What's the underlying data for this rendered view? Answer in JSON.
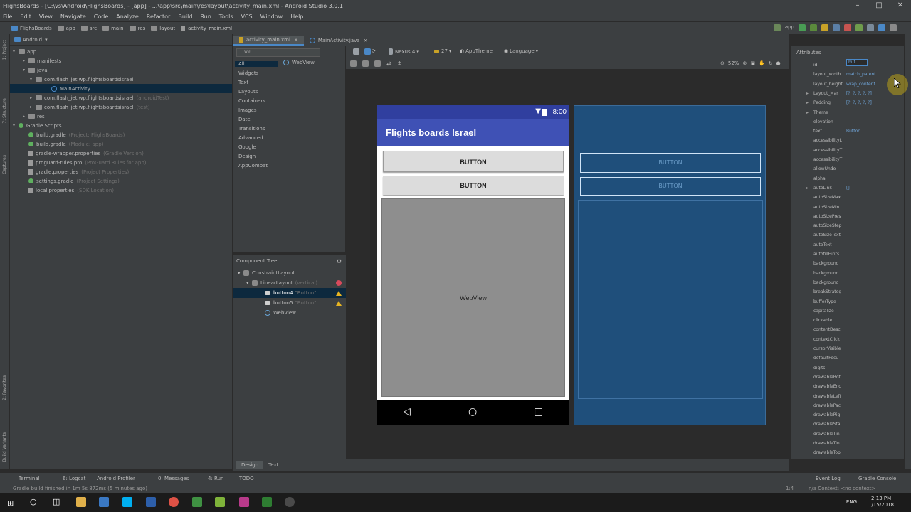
{
  "window": {
    "title": "FlighsBoards - [C:\\vs\\Android\\FlighsBoards] - [app] - ...\\app\\src\\main\\res\\layout\\activity_main.xml - Android Studio 3.0.1"
  },
  "menu": [
    "File",
    "Edit",
    "View",
    "Navigate",
    "Code",
    "Analyze",
    "Refactor",
    "Build",
    "Run",
    "Tools",
    "VCS",
    "Window",
    "Help"
  ],
  "breadcrumb": [
    "FlighsBoards",
    "app",
    "src",
    "main",
    "res",
    "layout",
    "activity_main.xml"
  ],
  "run_config": "app",
  "project": {
    "view_mode": "Android",
    "items": [
      {
        "label": "app",
        "ghost": ""
      },
      {
        "label": "manifests",
        "ghost": ""
      },
      {
        "label": "java",
        "ghost": ""
      },
      {
        "label": "com.flash_jet.wp.flightsboardsisrael",
        "ghost": ""
      },
      {
        "label": "MainActivity",
        "ghost": ""
      },
      {
        "label": "com.flash_jet.wp.flightsboardsisrael",
        "ghost": "(androidTest)"
      },
      {
        "label": "com.flash_jet.wp.flightsboardsisrael",
        "ghost": "(test)"
      },
      {
        "label": "res",
        "ghost": ""
      },
      {
        "label": "Gradle Scripts",
        "ghost": ""
      },
      {
        "label": "build.gradle",
        "ghost": "(Project: FlighsBoards)"
      },
      {
        "label": "build.gradle",
        "ghost": "(Module: app)"
      },
      {
        "label": "gradle-wrapper.properties",
        "ghost": "(Gradle Version)"
      },
      {
        "label": "proguard-rules.pro",
        "ghost": "(ProGuard Rules for app)"
      },
      {
        "label": "gradle.properties",
        "ghost": "(Project Properties)"
      },
      {
        "label": "settings.gradle",
        "ghost": "(Project Settings)"
      },
      {
        "label": "local.properties",
        "ghost": "(SDK Location)"
      }
    ]
  },
  "tabs": [
    "activity_main.xml",
    "MainActivity.java"
  ],
  "palette": {
    "search": "we",
    "categories": [
      "All",
      "Widgets",
      "Text",
      "Layouts",
      "Containers",
      "Images",
      "Date",
      "Transitions",
      "Advanced",
      "Google",
      "Design",
      "AppCompat"
    ],
    "result": "WebView"
  },
  "design_toolbar": {
    "device": "Nexus 4",
    "api": "27",
    "theme": "AppTheme",
    "language": "Language",
    "zoom": "52%"
  },
  "phone": {
    "time": "8:00",
    "app_title": "Flights boards Israel",
    "button1": "BUTTON",
    "button2": "BUTTON",
    "webview": "WebView"
  },
  "blueprint": {
    "button1": "BUTTON",
    "button2": "BUTTON"
  },
  "component_tree": {
    "title": "Component Tree",
    "items": [
      {
        "label": "ConstraintLayout",
        "ghost": ""
      },
      {
        "label": "LinearLayout",
        "ghost": "(vertical)"
      },
      {
        "label": "button4",
        "ghost": "\"Button\""
      },
      {
        "label": "button5",
        "ghost": "\"Button\""
      },
      {
        "label": "WebView",
        "ghost": ""
      }
    ]
  },
  "attributes": {
    "title": "Attributes",
    "id_value": "but",
    "rows": [
      {
        "name": "id",
        "value": ""
      },
      {
        "name": "layout_width",
        "value": "match_parent"
      },
      {
        "name": "layout_height",
        "value": "wrap_content"
      },
      {
        "name": "Layout_Mar",
        "value": "[?, ?, ?, ?, ?]"
      },
      {
        "name": "Padding",
        "value": "[?, ?, ?, ?, ?]"
      },
      {
        "name": "Theme",
        "value": ""
      },
      {
        "name": "elevation",
        "value": ""
      },
      {
        "name": "text",
        "value": "Button"
      },
      {
        "name": "accessibilityL",
        "value": ""
      },
      {
        "name": "accessibilityT",
        "value": ""
      },
      {
        "name": "accessibilityT",
        "value": ""
      },
      {
        "name": "allowUndo",
        "value": ""
      },
      {
        "name": "alpha",
        "value": ""
      },
      {
        "name": "autoLink",
        "value": "[]"
      },
      {
        "name": "autoSizeMax",
        "value": ""
      },
      {
        "name": "autoSizeMin",
        "value": ""
      },
      {
        "name": "autoSizePres",
        "value": ""
      },
      {
        "name": "autoSizeStep",
        "value": ""
      },
      {
        "name": "autoSizeText",
        "value": ""
      },
      {
        "name": "autoText",
        "value": ""
      },
      {
        "name": "autofillHints",
        "value": ""
      },
      {
        "name": "background",
        "value": ""
      },
      {
        "name": "background",
        "value": ""
      },
      {
        "name": "background",
        "value": ""
      },
      {
        "name": "breakStrateg",
        "value": ""
      },
      {
        "name": "bufferType",
        "value": ""
      },
      {
        "name": "capitalize",
        "value": ""
      },
      {
        "name": "clickable",
        "value": ""
      },
      {
        "name": "contentDesc",
        "value": ""
      },
      {
        "name": "contextClick",
        "value": ""
      },
      {
        "name": "cursorVisible",
        "value": ""
      },
      {
        "name": "defaultFocu",
        "value": ""
      },
      {
        "name": "digits",
        "value": ""
      },
      {
        "name": "drawableBot",
        "value": ""
      },
      {
        "name": "drawableEnc",
        "value": ""
      },
      {
        "name": "drawableLeft",
        "value": ""
      },
      {
        "name": "drawablePac",
        "value": ""
      },
      {
        "name": "drawableRig",
        "value": ""
      },
      {
        "name": "drawableSta",
        "value": ""
      },
      {
        "name": "drawableTin",
        "value": ""
      },
      {
        "name": "drawableTin",
        "value": ""
      },
      {
        "name": "drawableTop",
        "value": ""
      }
    ]
  },
  "editor_mode_tabs": [
    "Design",
    "Text"
  ],
  "tool_windows": [
    "Terminal",
    "6: Logcat",
    "Android Profiler",
    "0: Messages",
    "4: Run",
    "TODO",
    "Event Log",
    "Gradle Console"
  ],
  "status": {
    "message": "Gradle build finished in 1m 5s 872ms (5 minutes ago)",
    "position": "1:4",
    "context": "n/a   Context: <no context>"
  },
  "taskbar": {
    "lang": "ENG",
    "time": "2:13 PM",
    "date": "1/15/2018"
  },
  "colors": {
    "ide_bg": "#3c3f41",
    "editor_bg": "#2b2b2b",
    "primary_dark": "#303f9f",
    "primary": "#3f51b5",
    "blueprint": "#1f4f7b"
  }
}
